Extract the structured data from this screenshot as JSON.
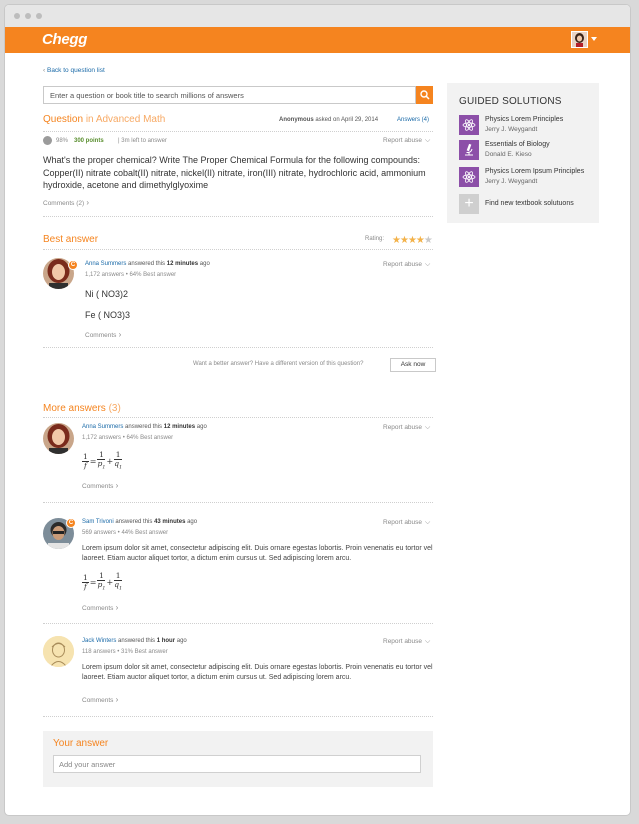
{
  "header": {
    "logo": "Chegg"
  },
  "nav": {
    "back": "Back to question list"
  },
  "search": {
    "placeholder": "Enter a question or book title to search millions of answers"
  },
  "question": {
    "label": "Question",
    "subject": "in Advanced Math",
    "asker": "Anonymous",
    "asked_on": "asked on April 29, 2014",
    "answers_link": "Answers (4)",
    "percent": "98%",
    "points": "300 points",
    "time_left": "3m left to answer",
    "report": "Report abuse",
    "text": "What's the proper chemical? Write The Proper Chemical Formula for the following compounds: Copper(II) nitrate cobalt(II) nitrate, nickel(II) nitrate, iron(III) nitrate, hydrochloric acid, ammonium hydroxide, acetone and dimethylglyoxime",
    "comments": "Comments (2)"
  },
  "best_answer": {
    "heading": "Best answer",
    "rating_label": "Rating:",
    "rating": 4,
    "rating_max": 5,
    "author": "Anna Summers",
    "answered_prefix": "answered this",
    "time": "12 minutes",
    "time_suffix": "ago",
    "stats": "1,172 answers • 64% Best answer",
    "report": "Report abuse",
    "line1": "Ni ( NO3)2",
    "line2": "Fe ( NO3)3",
    "comments": "Comments",
    "prompt": "Want a better answer? Have a different version of this question?",
    "ask_button": "Ask now"
  },
  "more_answers": {
    "heading": "More answers",
    "count": "(3)",
    "items": [
      {
        "author": "Anna Summers",
        "answered_prefix": "answered this",
        "time": "12 minutes",
        "time_suffix": "ago",
        "stats": "1,172 answers • 64% Best answer",
        "report": "Report abuse",
        "comments": "Comments"
      },
      {
        "author": "Sam Trivoni",
        "answered_prefix": "answered this",
        "time": "43 minutes",
        "time_suffix": "ago",
        "stats": "569 answers • 44% Best answer",
        "report": "Report abuse",
        "text": "Lorem ipsum dolor sit amet, consectetur adipiscing elit. Duis ornare egestas lobortis. Proin venenatis eu tortor vel laoreet. Etiam auctor aliquet tortor, a dictum enim cursus ut. Sed adipiscing lorem arcu.",
        "comments": "Comments"
      },
      {
        "author": "Jack Winters",
        "answered_prefix": "answered this",
        "time": "1 hour",
        "time_suffix": "ago",
        "stats": "118 answers • 31% Best answer",
        "report": "Report abuse",
        "text": "Lorem ipsum dolor sit amet, consectetur adipiscing elit. Duis ornare egestas lobortis. Proin venenatis eu tortor vel laoreet. Etiam auctor aliquet tortor, a dictum enim cursus ut. Sed adipiscing lorem arcu.",
        "comments": "Comments"
      }
    ],
    "formula": {
      "one": "1",
      "f": "f",
      "p": "p",
      "q": "q",
      "sub": "1",
      "eq": "=",
      "plus": "+"
    }
  },
  "your_answer": {
    "heading": "Your answer",
    "placeholder": "Add your answer"
  },
  "sidebar": {
    "title": "GUIDED SOLUTIONS",
    "books": [
      {
        "title": "Physics Lorem Principles",
        "author": "Jerry J. Weygandt",
        "icon": "atom-icon"
      },
      {
        "title": "Essentials of Biology",
        "author": "Donald E. Kieso",
        "icon": "microscope-icon"
      },
      {
        "title": "Physics Lorem Ipsum Principles",
        "author": "Jerry J. Weygandt",
        "icon": "atom-icon"
      }
    ],
    "find_new": "Find new textbook solutuons"
  },
  "colors": {
    "accent": "#f5841f",
    "link": "#1a6aa8",
    "book": "#8c4fa8",
    "star": "#f3b24a"
  }
}
